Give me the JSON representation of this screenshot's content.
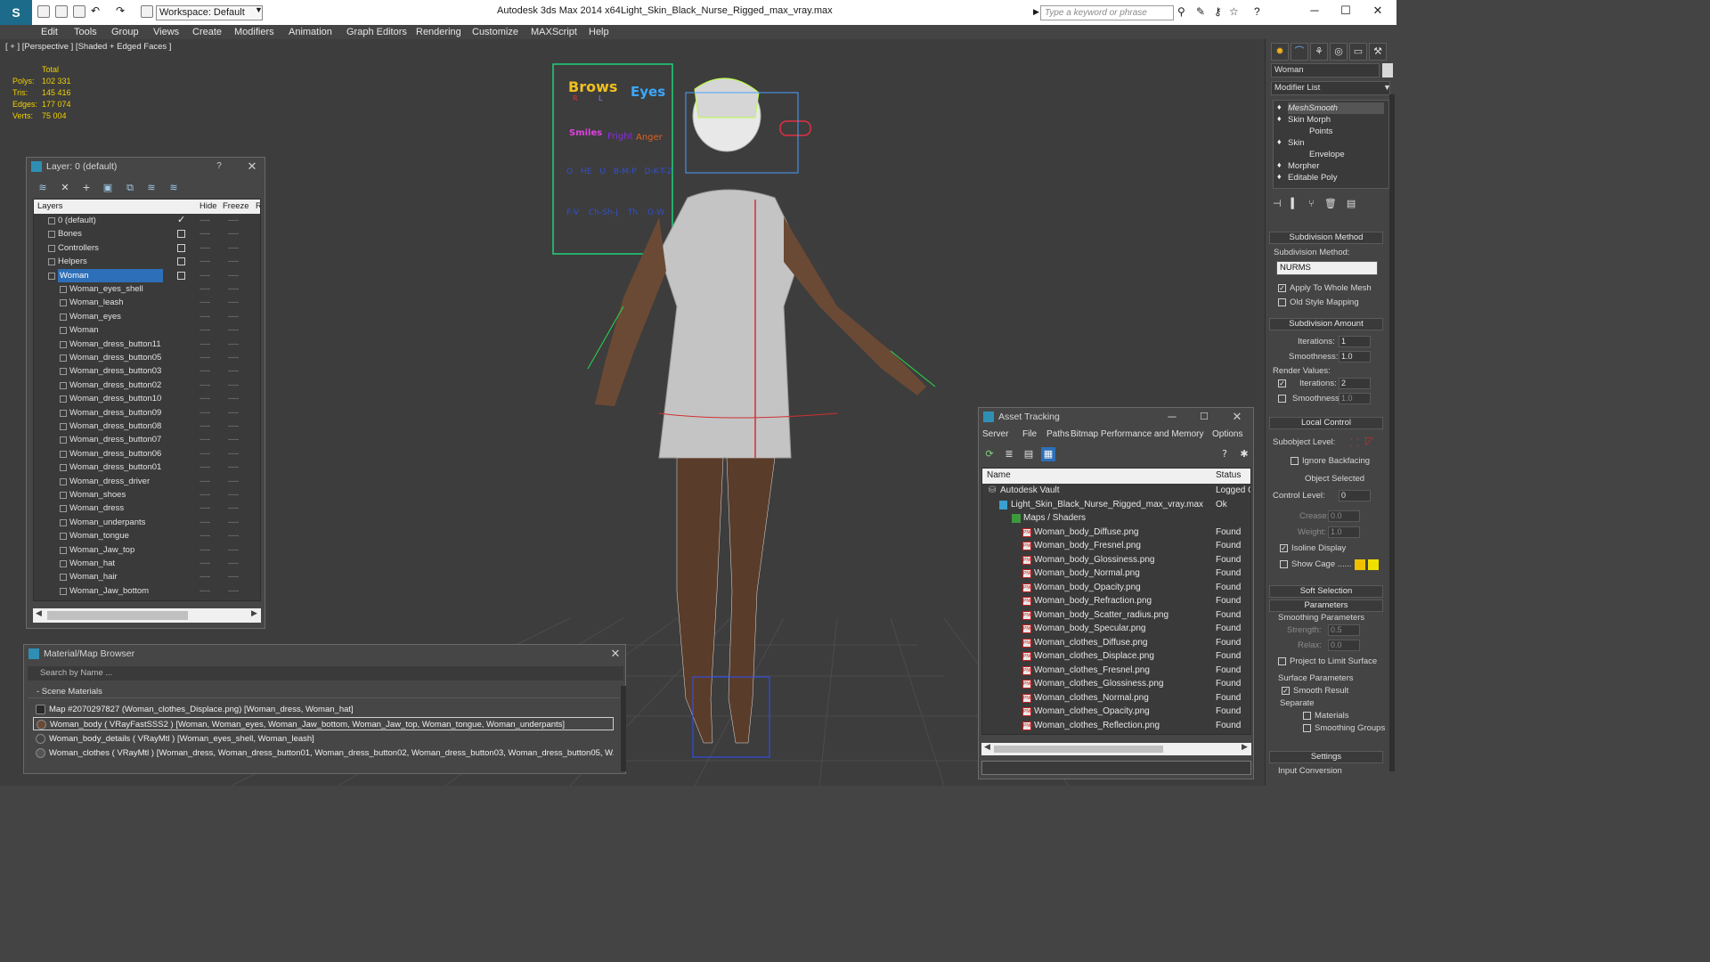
{
  "titlebar": {
    "workspace": "Workspace: Default",
    "app_title": "Autodesk 3ds Max  2014 x64",
    "file_name": "Light_Skin_Black_Nurse_Rigged_max_vray.max",
    "search_placeholder": "Type a keyword or phrase"
  },
  "menu": [
    "Edit",
    "Tools",
    "Group",
    "Views",
    "Create",
    "Modifiers",
    "Animation",
    "Graph Editors",
    "Rendering",
    "Customize",
    "MAXScript",
    "Help"
  ],
  "viewport": {
    "label": "[ + ] [Perspective ] [Shaded + Edged Faces ]",
    "stats": {
      "header": "Total",
      "polys_label": "Polys:",
      "polys": "102 331",
      "tris_label": "Tris:",
      "tris": "145 416",
      "edges_label": "Edges:",
      "edges": "177 074",
      "verts_label": "Verts:",
      "verts": "75 004"
    },
    "rig_panel": {
      "brows": "Brows",
      "eyes": "Eyes",
      "r": "R",
      "l": "L",
      "smiles": "Smiles",
      "fright": "Fright",
      "anger": "Anger",
      "row3": [
        "O",
        "HE",
        "U",
        "B-M-P",
        "D-K-T-Z"
      ],
      "row4": [
        "F-V",
        "Ch-Sh-J",
        "Th",
        "O-W"
      ]
    }
  },
  "layer_panel": {
    "title": "Layer: 0 (default)",
    "help": "?",
    "headers": {
      "layers": "Layers",
      "hide": "Hide",
      "freeze": "Freeze",
      "render": "R"
    },
    "rows": [
      {
        "name": "0 (default)",
        "level": 0,
        "checked": true
      },
      {
        "name": "Bones",
        "level": 0
      },
      {
        "name": "Controllers",
        "level": 0
      },
      {
        "name": "Helpers",
        "level": 0
      },
      {
        "name": "Woman",
        "level": 0,
        "selected": true
      },
      {
        "name": "Woman_eyes_shell",
        "level": 1
      },
      {
        "name": "Woman_leash",
        "level": 1
      },
      {
        "name": "Woman_eyes",
        "level": 1
      },
      {
        "name": "Woman",
        "level": 1
      },
      {
        "name": "Woman_dress_button11",
        "level": 1
      },
      {
        "name": "Woman_dress_button05",
        "level": 1
      },
      {
        "name": "Woman_dress_button03",
        "level": 1
      },
      {
        "name": "Woman_dress_button02",
        "level": 1
      },
      {
        "name": "Woman_dress_button10",
        "level": 1
      },
      {
        "name": "Woman_dress_button09",
        "level": 1
      },
      {
        "name": "Woman_dress_button08",
        "level": 1
      },
      {
        "name": "Woman_dress_button07",
        "level": 1
      },
      {
        "name": "Woman_dress_button06",
        "level": 1
      },
      {
        "name": "Woman_dress_button01",
        "level": 1
      },
      {
        "name": "Woman_dress_driver",
        "level": 1
      },
      {
        "name": "Woman_shoes",
        "level": 1
      },
      {
        "name": "Woman_dress",
        "level": 1
      },
      {
        "name": "Woman_underpants",
        "level": 1
      },
      {
        "name": "Woman_tongue",
        "level": 1
      },
      {
        "name": "Woman_Jaw_top",
        "level": 1
      },
      {
        "name": "Woman_hat",
        "level": 1
      },
      {
        "name": "Woman_hair",
        "level": 1
      },
      {
        "name": "Woman_Jaw_bottom",
        "level": 1
      }
    ]
  },
  "material_browser": {
    "title": "Material/Map Browser",
    "search_placeholder": "Search by Name ...",
    "group": "- Scene Materials",
    "rows": [
      "Map #2070297827 (Woman_clothes_Displace.png)  [Woman_dress, Woman_hat]",
      "Woman_body  ( VRayFastSSS2 ) [Woman, Woman_eyes, Woman_Jaw_bottom, Woman_Jaw_top, Woman_tongue, Woman_underpants]",
      "Woman_body_details  ( VRayMtl ) [Woman_eyes_shell, Woman_leash]",
      "Woman_clothes  ( VRayMtl ) [Woman_dress, Woman_dress_button01, Woman_dress_button02, Woman_dress_button03, Woman_dress_button05, W..."
    ]
  },
  "asset_tracking": {
    "title": "Asset Tracking",
    "menu": [
      "Server",
      "File",
      "Paths",
      "Bitmap Performance and Memory",
      "Options"
    ],
    "headers": {
      "name": "Name",
      "status": "Status"
    },
    "rows": [
      {
        "name": "Autodesk Vault",
        "status": "Logged O",
        "level": 0
      },
      {
        "name": "Light_Skin_Black_Nurse_Rigged_max_vray.max",
        "status": "Ok",
        "level": 1
      },
      {
        "name": "Maps / Shaders",
        "status": "",
        "level": 2
      },
      {
        "name": "Woman_body_Diffuse.png",
        "status": "Found",
        "level": 3
      },
      {
        "name": "Woman_body_Fresnel.png",
        "status": "Found",
        "level": 3
      },
      {
        "name": "Woman_body_Glossiness.png",
        "status": "Found",
        "level": 3
      },
      {
        "name": "Woman_body_Normal.png",
        "status": "Found",
        "level": 3
      },
      {
        "name": "Woman_body_Opacity.png",
        "status": "Found",
        "level": 3
      },
      {
        "name": "Woman_body_Refraction.png",
        "status": "Found",
        "level": 3
      },
      {
        "name": "Woman_body_Scatter_radius.png",
        "status": "Found",
        "level": 3
      },
      {
        "name": "Woman_body_Specular.png",
        "status": "Found",
        "level": 3
      },
      {
        "name": "Woman_clothes_Diffuse.png",
        "status": "Found",
        "level": 3
      },
      {
        "name": "Woman_clothes_Displace.png",
        "status": "Found",
        "level": 3
      },
      {
        "name": "Woman_clothes_Fresnel.png",
        "status": "Found",
        "level": 3
      },
      {
        "name": "Woman_clothes_Glossiness.png",
        "status": "Found",
        "level": 3
      },
      {
        "name": "Woman_clothes_Normal.png",
        "status": "Found",
        "level": 3
      },
      {
        "name": "Woman_clothes_Opacity.png",
        "status": "Found",
        "level": 3
      },
      {
        "name": "Woman_clothes_Reflection.png",
        "status": "Found",
        "level": 3
      }
    ]
  },
  "command_panel": {
    "object_name": "Woman",
    "modifier_list": "Modifier List",
    "stack": [
      {
        "name": "MeshSmooth",
        "italic": true,
        "level": 0
      },
      {
        "name": "Skin Morph",
        "level": 0
      },
      {
        "name": "Points",
        "level": 1
      },
      {
        "name": "Skin",
        "level": 0
      },
      {
        "name": "Envelope",
        "level": 1
      },
      {
        "name": "Morpher",
        "level": 0
      },
      {
        "name": "Editable Poly",
        "level": 0
      }
    ],
    "subdivision_method_header": "Subdivision Method",
    "subdivision_method_label": "Subdivision Method:",
    "subdivision_method_value": "NURMS",
    "apply_whole_mesh": "Apply To Whole Mesh",
    "old_style_mapping": "Old Style Mapping",
    "subdivision_amount_header": "Subdivision Amount",
    "iterations_label": "Iterations:",
    "iterations": "1",
    "smoothness_label": "Smoothness:",
    "smoothness": "1.0",
    "render_values": "Render Values:",
    "render_iterations": "2",
    "render_smoothness": "1.0",
    "local_control_header": "Local Control",
    "subobject_level": "Subobject Level:",
    "ignore_backfacing": "Ignore Backfacing",
    "object_selected": "Object Selected",
    "control_level_label": "Control Level:",
    "control_level": "0",
    "crease_label": "Crease:",
    "crease": "0.0",
    "weight_label": "Weight:",
    "weight": "1.0",
    "isoline_display": "Isoline Display",
    "show_cage": "Show Cage ......",
    "soft_selection": "Soft Selection",
    "parameters": "Parameters",
    "smoothing_parameters": "Smoothing Parameters",
    "strength_label": "Strength:",
    "strength": "0.5",
    "relax_label": "Relax:",
    "relax": "0.0",
    "project_limit": "Project to Limit Surface",
    "surface_parameters": "Surface Parameters",
    "smooth_result": "Smooth Result",
    "separate": "Separate",
    "materials": "Materials",
    "smoothing_groups": "Smoothing Groups",
    "settings": "Settings",
    "input_conversion": "Input Conversion"
  }
}
